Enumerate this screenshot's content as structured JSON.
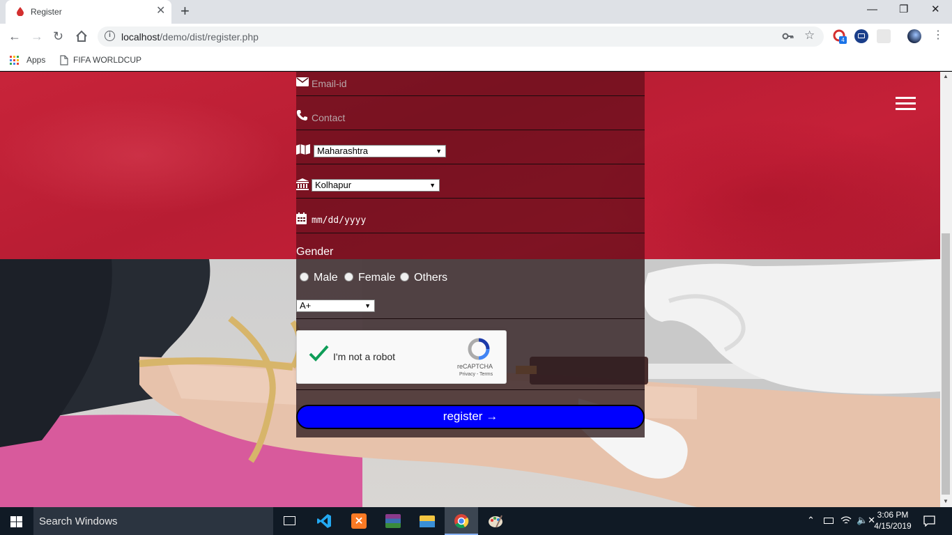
{
  "browser": {
    "tab_title": "Register",
    "url_host": "localhost",
    "url_path": "/demo/dist/register.php",
    "extension_badge": "4",
    "bookmarks": [
      {
        "label": "Apps"
      },
      {
        "label": "FIFA WORLDCUP"
      }
    ]
  },
  "form": {
    "email_placeholder": "Email-id",
    "contact_placeholder": "Contact",
    "state_value": "Maharashtra",
    "city_value": "Kolhapur",
    "date_placeholder": "mm/dd/yyyy",
    "gender_label": "Gender",
    "gender_options": [
      "Male",
      "Female",
      "Others"
    ],
    "blood_group_value": "A+",
    "captcha_label": "I'm not a robot",
    "captcha_brand": "reCAPTCHA",
    "captcha_terms": "Privacy - Terms",
    "register_label": "register →"
  },
  "taskbar": {
    "search_text": "Search Windows",
    "time": "3:06 PM",
    "date": "4/15/2019"
  },
  "colors": {
    "header_red": "#c8243a",
    "register_blue": "#0000ff",
    "captcha_check": "#0f9d58"
  }
}
